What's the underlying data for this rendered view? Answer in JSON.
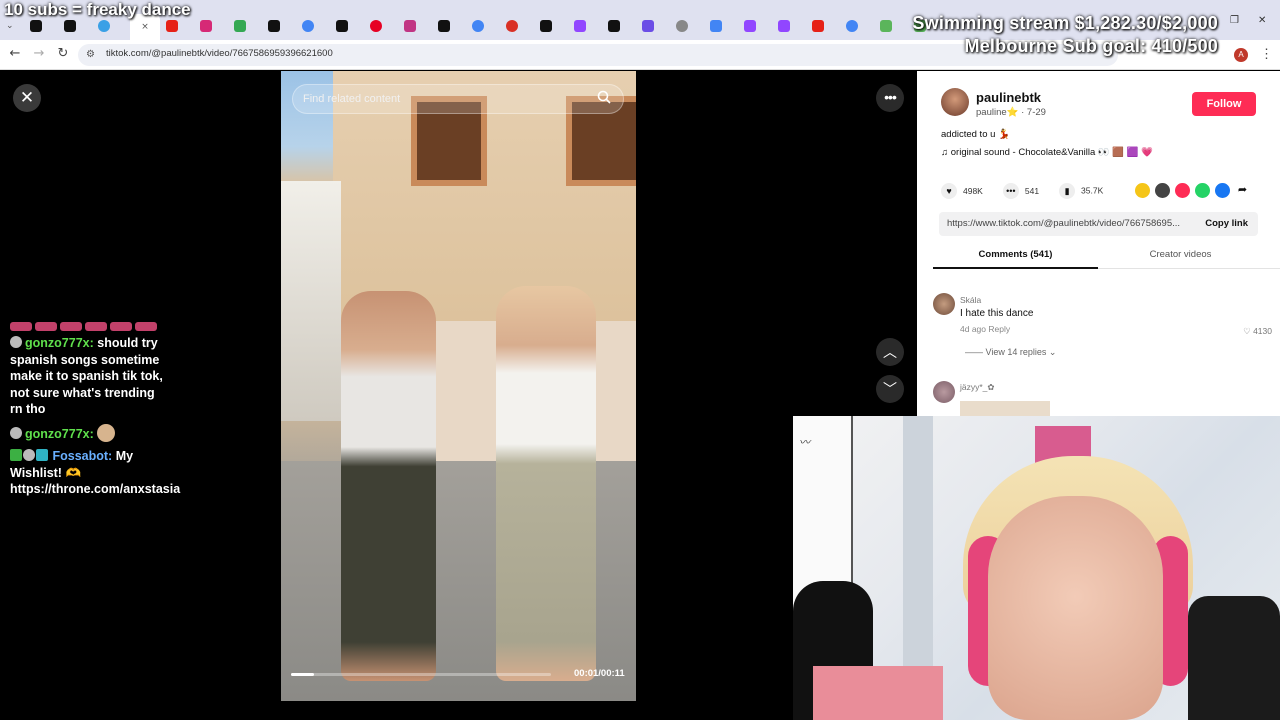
{
  "overlay": {
    "top_left": "10 subs = freaky dance",
    "goal_line1": "Swimming stream $1,282.30/$2,000",
    "goal_line2": "Melbourne Sub goal: 410/500"
  },
  "browser": {
    "url": "tiktok.com/@paulinebtk/video/7667586959396621600",
    "profile_initial": "A"
  },
  "video": {
    "search_placeholder": "Find related content",
    "time": "00:01/00:11",
    "progress": 0.09
  },
  "chat": {
    "messages": [
      {
        "user": "gonzo777x:",
        "text": "should try spanish songs sometime make it to spanish tik tok, not sure what's trending rn tho"
      },
      {
        "user": "gonzo777x:",
        "text": ""
      },
      {
        "user": "Fossabot:",
        "text": "My Wishlist! 🫶 https://throne.com/anxstasia"
      }
    ]
  },
  "panel": {
    "username": "paulinebtk",
    "subline": "pauline⭐ · 7-29",
    "follow_label": "Follow",
    "description": "addicted to u 💃",
    "sound": "original sound - Chocolate&Vanilla 👀 🟫 🟪 💗",
    "likes": "498K",
    "comments": "541",
    "saves": "35.7K",
    "link": "https://www.tiktok.com/@paulinebtk/video/766758695...",
    "copy_label": "Copy link",
    "tab_comments": "Comments (541)",
    "tab_creator": "Creator videos",
    "comment1": {
      "user": "Skála",
      "text": "I hate this dance",
      "meta": "4d ago   Reply",
      "likes": "4130",
      "replies": "View 14 replies"
    },
    "comment2": {
      "user": "jäzyy*_✿"
    }
  }
}
